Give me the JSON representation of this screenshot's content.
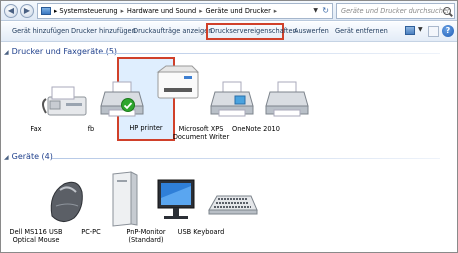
{
  "breadcrumb": [
    "Systemsteuerung",
    "Hardware und Sound",
    "Geräte und Drucker"
  ],
  "search": {
    "placeholder": "Geräte und Drucker durchsuchen"
  },
  "toolbar": {
    "add_device": "Gerät hinzufügen",
    "add_printer": "Drucker hinzufügen",
    "show_jobs": "Druckaufträge anzeigen",
    "server_props": "Druckservereigenschaften",
    "eject": "Auswerfen",
    "remove_device": "Gerät entfernen",
    "help": "?"
  },
  "groups": {
    "printers": {
      "title": "Drucker und Faxgeräte (5)"
    },
    "devices": {
      "title": "Geräte (4)"
    }
  },
  "printers": [
    {
      "label": "Fax"
    },
    {
      "label": "fb"
    },
    {
      "label": "HP printer",
      "selected": true,
      "default": true
    },
    {
      "label": "Microsoft XPS Document Writer"
    },
    {
      "label": "OneNote 2010"
    }
  ],
  "devices": [
    {
      "label": "Dell MS116 USB Optical Mouse"
    },
    {
      "label": "PC-PC"
    },
    {
      "label": "PnP-Monitor (Standard)"
    },
    {
      "label": "USB Keyboard"
    }
  ],
  "colors": {
    "highlight": "#d0402a",
    "selection": "#dfeefe",
    "group_heading": "#1e3f8c"
  },
  "icons": {
    "back": "back-arrow-icon",
    "forward": "forward-arrow-icon",
    "default_check": "green-check-icon"
  }
}
